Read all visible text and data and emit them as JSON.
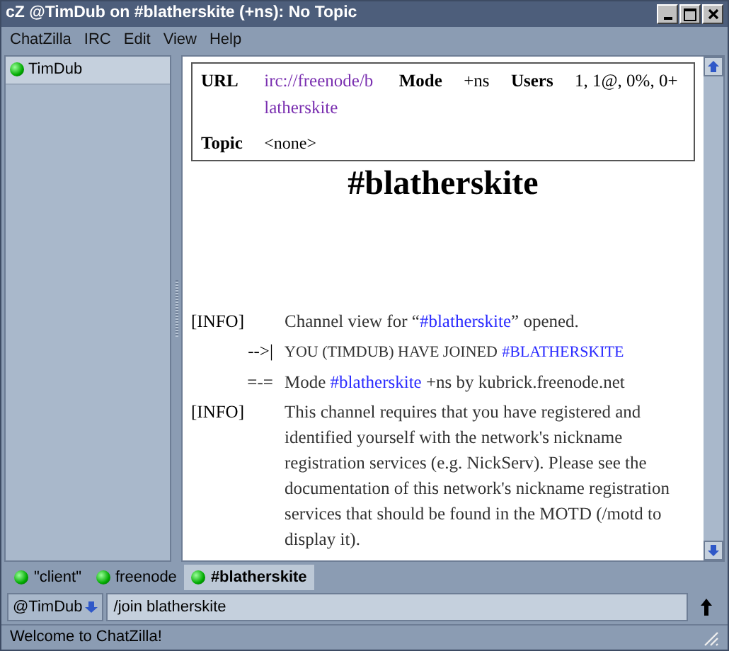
{
  "window": {
    "title": "cZ @TimDub on #blatherskite (+ns): No Topic"
  },
  "menu": [
    "ChatZilla",
    "IRC",
    "Edit",
    "View",
    "Help"
  ],
  "userlist": [
    {
      "nick": "TimDub",
      "selected": false
    }
  ],
  "header": {
    "url_label": "URL",
    "url": "irc://freenode/blatherskite",
    "mode_label": "Mode",
    "mode": "+ns",
    "users_label": "Users",
    "users": "1, 1@, 0%, 0+",
    "topic_label": "Topic",
    "topic": "<none>"
  },
  "channel_title": "#blatherskite",
  "messages": [
    {
      "kind": "info",
      "prefix": "[INFO]",
      "parts": [
        {
          "text": "Channel view for “",
          "link": false
        },
        {
          "text": "#blatherskite",
          "link": true
        },
        {
          "text": "” opened.",
          "link": false
        }
      ]
    },
    {
      "kind": "join",
      "prefix": "-->|",
      "parts": [
        {
          "text": "YOU (TIMDUB) HAVE JOINED",
          "link": false
        },
        {
          "text": "#BLATHERSKITE",
          "link": true
        }
      ]
    },
    {
      "kind": "mode",
      "prefix": "=-=",
      "parts": [
        {
          "text": "Mode",
          "link": false
        },
        {
          "text": "#blatherskite",
          "link": true
        },
        {
          "text": "+ns by kubrick.freenode.net",
          "link": false
        }
      ]
    },
    {
      "kind": "info",
      "prefix": "[INFO]",
      "parts": [
        {
          "text": "This channel requires that you have registered and identified yourself with the network's nickname registration services (e.g. NickServ). Please see the documentation of this network's nickname registration services that should be found in the MOTD (/motd to display it).",
          "link": false
        }
      ]
    }
  ],
  "tabs": [
    {
      "label": "\"client\"",
      "selected": false
    },
    {
      "label": "freenode",
      "selected": false
    },
    {
      "label": "#blatherskite",
      "selected": true
    }
  ],
  "nick_button": "@TimDub",
  "input": {
    "value": "/join blatherskite"
  },
  "status": "Welcome to ChatZilla!"
}
